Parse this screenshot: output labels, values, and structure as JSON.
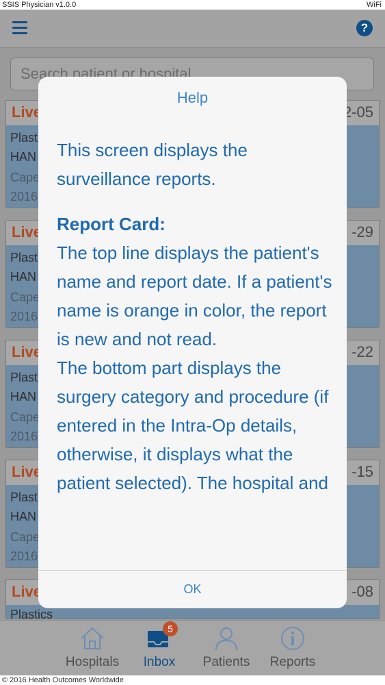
{
  "status_bar": {
    "app_name": "SSIS Physician v1.0.0",
    "network": "WiFi"
  },
  "search": {
    "placeholder": "Search patient or hospital"
  },
  "reports": [
    {
      "name": "Live",
      "date": "2-05",
      "category": "Plast",
      "procedure": "HAN",
      "hospital": "Cape",
      "year": "2016"
    },
    {
      "name": "Live",
      "date": "-29",
      "category": "Plast",
      "procedure": "HAN",
      "hospital": "Cape",
      "year": "2016"
    },
    {
      "name": "Live",
      "date": "-22",
      "category": "Plast",
      "procedure": "HAN",
      "hospital": "Cape",
      "year": "2016"
    },
    {
      "name": "Live",
      "date": "-15",
      "category": "Plast",
      "procedure": "HAN",
      "hospital": "Cape",
      "year": "2016"
    },
    {
      "name": "Live",
      "date": "-08",
      "category": "Plastics"
    }
  ],
  "help_dialog": {
    "title": "Help",
    "intro": "This screen displays the surveillance reports.",
    "section_heading": "Report Card:",
    "paragraph_1": "The top line displays the patient's name and report date. If a patient's name is orange in color, the report is new and not read.",
    "paragraph_2": "The bottom part displays the surgery category and procedure (if entered in the Intra-Op details, otherwise, it displays what the patient selected). The hospital and",
    "ok_label": "OK"
  },
  "tabs": [
    {
      "label": "Hospitals",
      "icon": "home-icon"
    },
    {
      "label": "Inbox",
      "icon": "inbox-icon",
      "badge": "5",
      "active": true
    },
    {
      "label": "Patients",
      "icon": "person-icon"
    },
    {
      "label": "Reports",
      "icon": "info-icon"
    }
  ],
  "footer": {
    "text": "© 2016 Health Outcomes Worldwide"
  },
  "colors": {
    "accent": "#1f6ab0",
    "dialog_title": "#3d86c6",
    "unread_name": "#b34a22",
    "badge": "#c0502b",
    "card_body": "#6e8ba6"
  }
}
